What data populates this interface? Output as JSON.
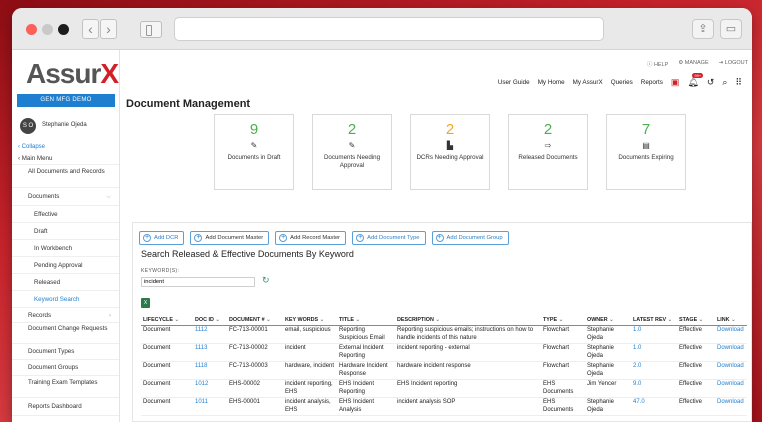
{
  "browser": {},
  "sidebar": {
    "logo_prefix": "Assur",
    "logo_suffix": "X",
    "demo_label": "GEN MFG DEMO",
    "avatar_initials": "S O",
    "user_name": "Stephanie Ojeda",
    "collapse": "‹ Collapse",
    "main_menu": "‹ Main Menu",
    "items": [
      "All Documents and Records",
      "Documents",
      "Effective",
      "Draft",
      "In Workbench",
      "Pending Approval",
      "Released",
      "Keyword Search",
      "Records",
      "Document Change Requests",
      "Document Types",
      "Document Groups",
      "Training Exam Templates",
      "Reports Dashboard"
    ]
  },
  "header": {
    "help": "HELP",
    "manage": "MANAGE",
    "logout": "LOGOUT",
    "nav": [
      "User Guide",
      "My Home",
      "My AssurX",
      "Queries",
      "Reports"
    ],
    "badge": "99+"
  },
  "page_title": "Document Management",
  "cards": [
    {
      "num": "9",
      "label": "Documents in Draft",
      "color": "#4caf50"
    },
    {
      "num": "2",
      "label": "Documents Needing Approval",
      "color": "#4caf50"
    },
    {
      "num": "2",
      "label": "DCRs Needing Approval",
      "color": "#f5a623"
    },
    {
      "num": "2",
      "label": "Released Documents",
      "color": "#4caf50"
    },
    {
      "num": "7",
      "label": "Documents Expiring",
      "color": "#4caf50"
    }
  ],
  "buttons": [
    "Add DCR",
    "Add Document Master",
    "Add Record Master",
    "Add Document Type",
    "Add Document Group"
  ],
  "search": {
    "title": "Search Released & Effective Documents By Keyword",
    "label": "KEYWORD(S):",
    "value": "incident"
  },
  "table": {
    "headers": [
      "LIFECYCLE",
      "DOC ID",
      "DOCUMENT #",
      "KEY WORDS",
      "TITLE",
      "DESCRIPTION",
      "TYPE",
      "OWNER",
      "LATEST REV",
      "STAGE",
      "LINK"
    ],
    "rows": [
      [
        "Document",
        "1112",
        "FC-713-00001",
        "email, suspicious",
        "Reporting Suspicious Email",
        "Reporting suspicious emails; instructions on how to handle incidents of this nature",
        "Flowchart",
        "Stephanie Ojeda",
        "1.0",
        "Effective",
        "Download"
      ],
      [
        "Document",
        "1113",
        "FC-713-00002",
        "incident",
        "External Incident Reporting",
        "incident reporting - external",
        "Flowchart",
        "Stephanie Ojeda",
        "1.0",
        "Effective",
        "Download"
      ],
      [
        "Document",
        "1118",
        "FC-713-00003",
        "hardware, incident",
        "Hardware Incident Response",
        "hardware incident response",
        "Flowchart",
        "Stephanie Ojeda",
        "2.0",
        "Effective",
        "Download"
      ],
      [
        "Document",
        "1012",
        "EHS-00002",
        "incident reporting, EHS",
        "EHS Incident Reporting",
        "EHS Incident reporting",
        "EHS Documents",
        "Jim Yencer",
        "9.0",
        "Effective",
        "Download"
      ],
      [
        "Document",
        "1011",
        "EHS-00001",
        "incident analysis, EHS",
        "EHS Incident Analysis",
        "incident analysis SOP",
        "EHS Documents",
        "Stephanie Ojeda",
        "47.0",
        "Effective",
        "Download"
      ]
    ]
  }
}
